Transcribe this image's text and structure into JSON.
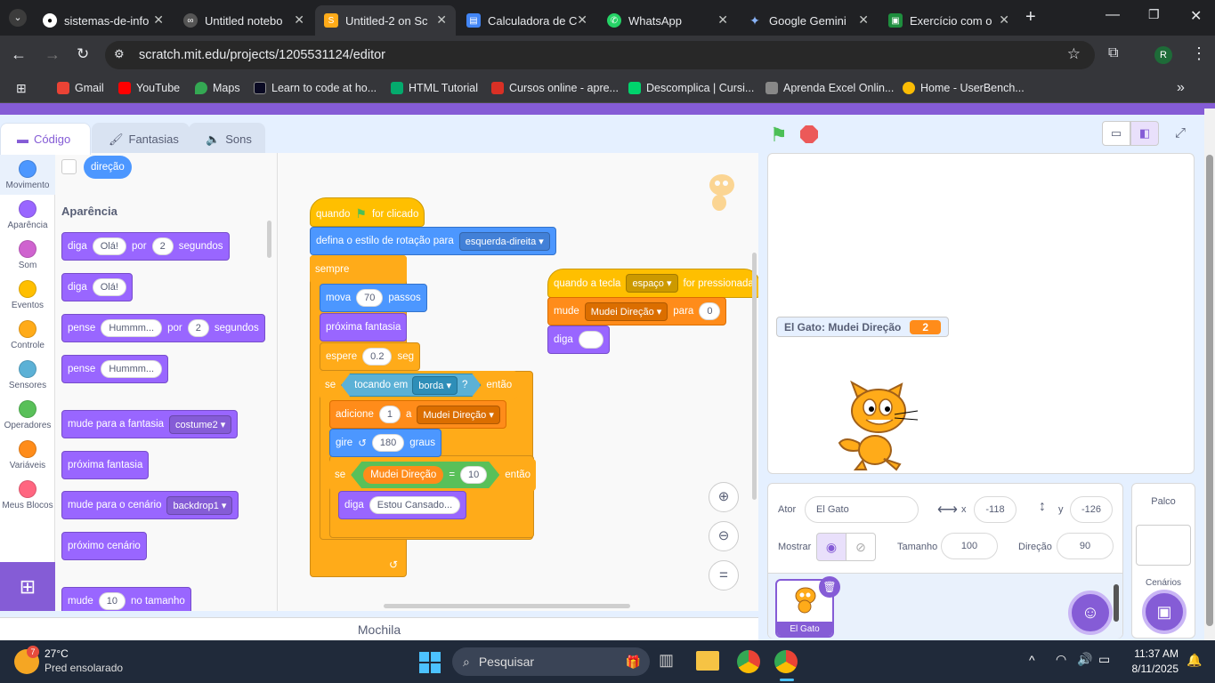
{
  "browser": {
    "tabs": [
      {
        "title": "sistemas-de-info",
        "icon": "github-icon"
      },
      {
        "title": "Untitled notebo",
        "icon": "colab-icon"
      },
      {
        "title": "Untitled-2 on Sc",
        "icon": "scratch-icon"
      },
      {
        "title": "Calculadora de C",
        "icon": "doc-icon"
      },
      {
        "title": "WhatsApp",
        "icon": "whatsapp-icon"
      },
      {
        "title": "Google Gemini",
        "icon": "gemini-icon"
      },
      {
        "title": "Exercício com o",
        "icon": "classroom-icon"
      }
    ],
    "url": "scratch.mit.edu/projects/1205531124/editor",
    "profile_initial": "R",
    "bookmarks": [
      "Gmail",
      "YouTube",
      "Maps",
      "Learn to code at ho...",
      "HTML Tutorial",
      "Cursos online - apre...",
      "Descomplica | Cursi...",
      "Aprenda Excel Onlin...",
      "Home - UserBench..."
    ]
  },
  "editor": {
    "tabs": {
      "code": "Código",
      "costumes": "Fantasias",
      "sounds": "Sons"
    },
    "categories": [
      {
        "label": "Movimento",
        "color": "#4c97ff"
      },
      {
        "label": "Aparência",
        "color": "#9966ff"
      },
      {
        "label": "Som",
        "color": "#cf63cf"
      },
      {
        "label": "Eventos",
        "color": "#ffbf00"
      },
      {
        "label": "Controle",
        "color": "#ffab19"
      },
      {
        "label": "Sensores",
        "color": "#5cb1d6"
      },
      {
        "label": "Operadores",
        "color": "#59c059"
      },
      {
        "label": "Variáveis",
        "color": "#ff8c1a"
      },
      {
        "label": "Meus Blocos",
        "color": "#ff6680"
      }
    ],
    "palette": {
      "direction_reporter": "direção",
      "section_title": "Aparência",
      "say_for": {
        "w1": "diga",
        "v1": "Olá!",
        "w2": "por",
        "v2": "2",
        "w3": "segundos"
      },
      "say": {
        "w1": "diga",
        "v1": "Olá!"
      },
      "think_for": {
        "w1": "pense",
        "v1": "Hummm...",
        "w2": "por",
        "v2": "2",
        "w3": "segundos"
      },
      "think": {
        "w1": "pense",
        "v1": "Hummm..."
      },
      "switch_costume": {
        "w1": "mude para a fantasia",
        "v1": "costume2"
      },
      "next_costume": "próxima fantasia",
      "switch_backdrop": {
        "w1": "mude para o cenário",
        "v1": "backdrop1"
      },
      "next_backdrop": "próximo cenário",
      "change_size": {
        "w1": "mude",
        "v1": "10",
        "w2": "no tamanho"
      }
    },
    "script1": {
      "hat": {
        "w1": "quando",
        "w2": "for clicado"
      },
      "rotation": {
        "w1": "defina o estilo de rotação para",
        "v1": "esquerda-direita"
      },
      "forever": "sempre",
      "move": {
        "w1": "mova",
        "v1": "70",
        "w2": "passos"
      },
      "next_costume": "próxima fantasia",
      "wait": {
        "w1": "espere",
        "v1": "0.2",
        "w2": "seg"
      },
      "if1": {
        "w1": "se",
        "touch": "tocando em",
        "target": "borda",
        "q": "?",
        "w2": "então"
      },
      "change_var": {
        "w1": "adicione",
        "v1": "1",
        "w2": "a",
        "var": "Mudei Direção"
      },
      "turn": {
        "w1": "gire",
        "v1": "180",
        "w2": "graus"
      },
      "if2": {
        "w1": "se",
        "var": "Mudei Direção",
        "op": "=",
        "v1": "10",
        "w2": "então"
      },
      "say": {
        "w1": "diga",
        "v1": "Estou Cansado..."
      }
    },
    "script2": {
      "hat": {
        "w1": "quando a tecla",
        "key": "espaço",
        "w2": "for pressionada"
      },
      "set_var": {
        "w1": "mude",
        "var": "Mudei Direção",
        "w2": "para",
        "v1": "0"
      },
      "say": {
        "w1": "diga",
        "v1": ""
      }
    },
    "backpack": "Mochila"
  },
  "stage": {
    "monitor": {
      "label": "El Gato: Mudei Direção",
      "value": "2"
    }
  },
  "sprite_info": {
    "sprite_label": "Ator",
    "sprite_name": "El Gato",
    "x_label": "x",
    "x": "-118",
    "y_label": "y",
    "y": "-126",
    "show_label": "Mostrar",
    "size_label": "Tamanho",
    "size": "100",
    "direction_label": "Direção",
    "direction": "90",
    "thumb_name": "El Gato"
  },
  "stage_panel": {
    "title": "Palco",
    "backdrops_label": "Cenários"
  },
  "taskbar": {
    "temp": "27°C",
    "weather": "Pred ensolarado",
    "weather_badge": "7",
    "search": "Pesquisar",
    "time": "11:37 AM",
    "date": "8/11/2025"
  }
}
